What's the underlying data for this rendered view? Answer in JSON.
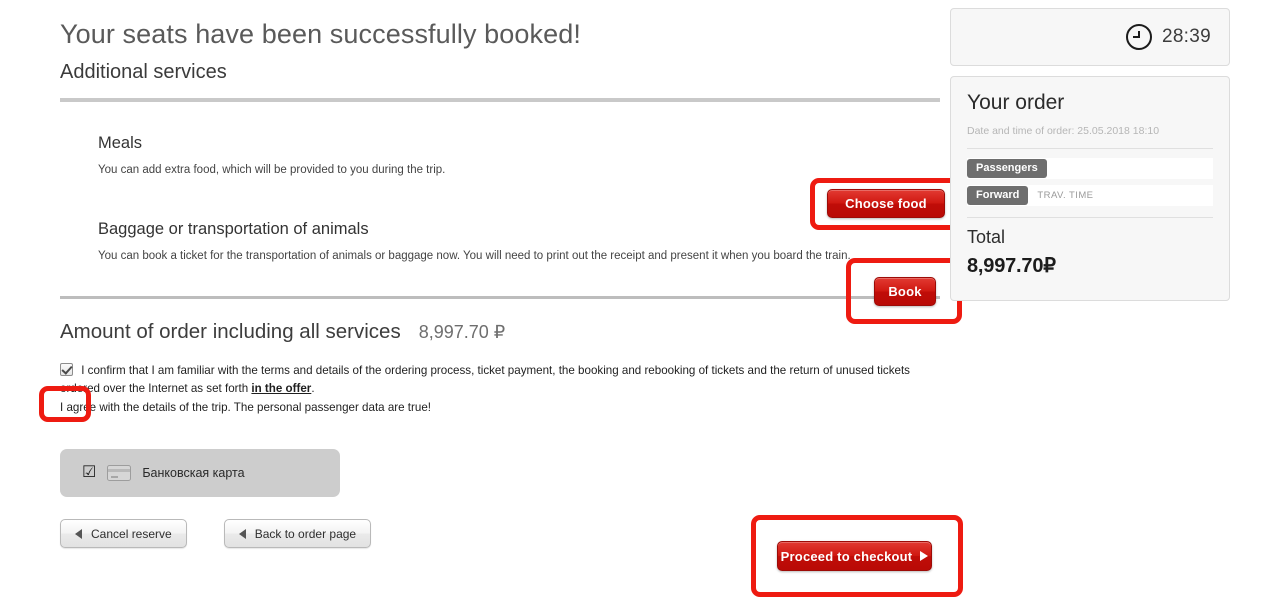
{
  "header": {
    "success_title": "Your seats have been successfully booked!",
    "section_title": "Additional services"
  },
  "services": [
    {
      "title": "Meals",
      "description": "You can add extra food, which will be provided to you during the trip.",
      "button_label": "Choose food"
    },
    {
      "title": "Baggage or transportation of animals",
      "description": "You can book a ticket for the transportation of animals or baggage now. You will need to print out the receipt and present it when you board the train.",
      "button_label": "Book"
    }
  ],
  "amount": {
    "label": "Amount of order including all services",
    "value": "8,997.70 ₽"
  },
  "consent": {
    "checked": true,
    "text_part1": "I confirm that I am familiar with the terms and details of the ordering process, ticket payment, the booking and rebooking of tickets and the return of unused tickets ordered over the Internet as set forth ",
    "link_label": "in the offer",
    "text_part2": ".",
    "line2": "I agree with the details of the trip. The personal passenger data are true!"
  },
  "payment": {
    "method_label": "Банковская карта",
    "selected": true,
    "check_glyph": "☑"
  },
  "footer": {
    "cancel_label": "Cancel reserve",
    "back_label": "Back to order page",
    "checkout_label": "Proceed to checkout"
  },
  "sidebar": {
    "timer": "28:39",
    "order_title": "Your order",
    "order_date": "Date and time of order: 25.05.2018 18:10",
    "rows": [
      {
        "tag": "Passengers",
        "value": ""
      },
      {
        "tag": "Forward",
        "value": "TRAV. TIME"
      }
    ],
    "total_label": "Total",
    "total_value": "8,997.70₽"
  },
  "colors": {
    "accent_red": "#ee1b11",
    "button_red": "#cf1710",
    "tag_grey": "#6e6e6e",
    "panel_grey": "#f7f7f7"
  }
}
